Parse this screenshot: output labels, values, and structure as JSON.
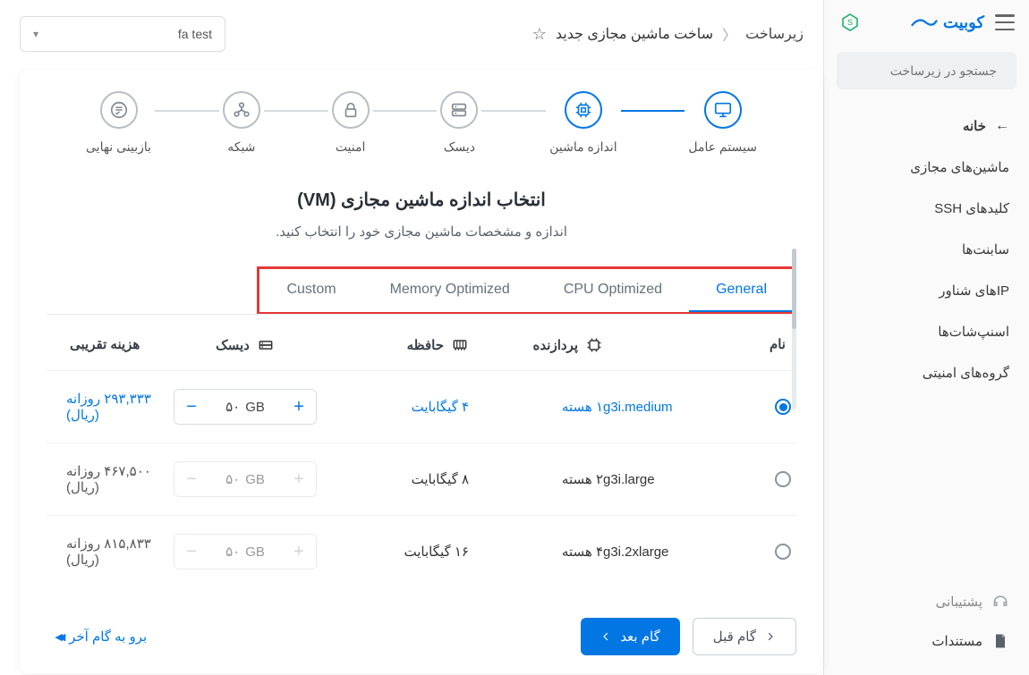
{
  "brand": {
    "name": "کوبیت"
  },
  "search": {
    "placeholder": "جستجو در زیرساخت"
  },
  "nav": {
    "home": "خانه",
    "items": [
      "ماشین‌های مجازی",
      "کلیدهای SSH",
      "سابنت‌ها",
      "IPهای شناور",
      "اسنپ‌شات‌ها",
      "گروه‌های امنیتی"
    ],
    "support": "پشتیبانی",
    "docs": "مستندات"
  },
  "breadcrumb": {
    "root": "زیرساخت",
    "current": "ساخت ماشین مجازی جدید"
  },
  "project": {
    "selected": "fa test"
  },
  "steps": [
    "سیستم عامل",
    "اندازه ماشین",
    "دیسک",
    "امنیت",
    "شبکه",
    "بازبینی نهایی"
  ],
  "section": {
    "title": "انتخاب اندازه ماشین مجازی (VM)",
    "subtitle": "اندازه و مشخصات ماشین مجازی خود را انتخاب کنید."
  },
  "tabs": [
    "General",
    "CPU Optimized",
    "Memory Optimized",
    "Custom"
  ],
  "table": {
    "headers": {
      "name": "نام",
      "cpu": "پردازنده",
      "mem": "حافظه",
      "disk": "دیسک",
      "cost": "هزینه تقریبی"
    },
    "disk_unit": "GB",
    "rows": [
      {
        "name": "g3i.medium",
        "cpu": "۱ هسته",
        "mem": "۴ گیگابایت",
        "disk": "۵۰",
        "cost": "۲۹۳,۳۳۳ روزانه (ریال)",
        "selected": true
      },
      {
        "name": "g3i.large",
        "cpu": "۲ هسته",
        "mem": "۸ گیگابایت",
        "disk": "۵۰",
        "cost": "۴۶۷,۵۰۰ روزانه (ریال)",
        "selected": false
      },
      {
        "name": "g3i.2xlarge",
        "cpu": "۴ هسته",
        "mem": "۱۶ گیگابایت",
        "disk": "۵۰",
        "cost": "۸۱۵,۸۳۳ روزانه (ریال)",
        "selected": false
      }
    ]
  },
  "footer": {
    "prev": "گام قبل",
    "next": "گام بعد",
    "skip": "برو به گام آخر"
  }
}
